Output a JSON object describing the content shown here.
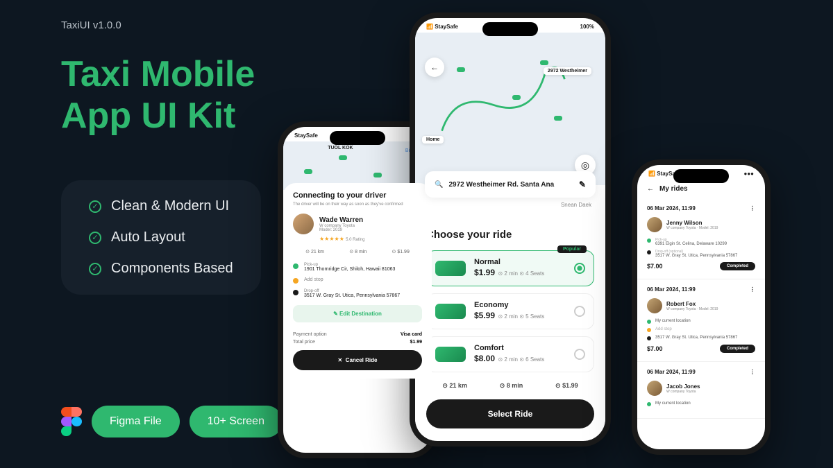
{
  "version": "TaxiUI v1.0.0",
  "title_line1": "Taxi Mobile",
  "title_line2": "App UI Kit",
  "features": [
    "Clean & Modern UI",
    "Auto Layout",
    "Components Based"
  ],
  "pills": [
    "Figma File",
    "10+ Screen"
  ],
  "phone1": {
    "carrier": "StaySafe",
    "map_labels": [
      "TUOL KOK",
      "Big Tree"
    ],
    "sheet_title": "Connecting to your driver",
    "sheet_sub": "The driver will be on their way as soon as they've confirmed",
    "driver_name": "Wade Warren",
    "driver_sub1": "W company Toyota",
    "driver_sub2": "Model: 2019",
    "rating_text": "5.0 Rating",
    "stats": [
      "21 km",
      "8 min",
      "$1.99"
    ],
    "locations": [
      {
        "label": "Pick-up",
        "addr": "1901 Thornridge Cir, Shiloh, Hawaii 81063"
      },
      {
        "label": "Add stop",
        "addr": ""
      },
      {
        "label": "Drop-off",
        "addr": "3517 W. Gray St. Utica, Pennsylvania 57867"
      }
    ],
    "edit_dest": "Edit Destination",
    "payment_label": "Payment option",
    "payment_value": "Visa card",
    "total_label": "Total price",
    "total_value": "$1.99",
    "cancel": "Cancel Ride"
  },
  "phone2": {
    "carrier": "StaySafe",
    "battery": "100%",
    "home_label": "Home",
    "dest_label": "2972 Westheimer",
    "search_addr": "2972 Westheimer Rd. Santa Ana",
    "map_text": "Snean Daek",
    "sheet_title": "Choose your ride",
    "rides": [
      {
        "name": "Normal",
        "price": "$1.99",
        "time": "2 min",
        "seats": "4 Seats",
        "popular": "Popular"
      },
      {
        "name": "Economy",
        "price": "$5.99",
        "time": "2 min",
        "seats": "5 Seats"
      },
      {
        "name": "Comfort",
        "price": "$8.00",
        "time": "2 min",
        "seats": "6 Seats"
      }
    ],
    "stats": [
      "21 km",
      "8 min",
      "$1.99"
    ],
    "select": "Select Ride"
  },
  "phone3": {
    "carrier": "StaySafe",
    "title": "My rides",
    "entries": [
      {
        "date": "06 Mar 2024, 11:99",
        "name": "Jenny Wilson",
        "sub": "W company Toyota · Model: 2019",
        "pickup_label": "Pick-up",
        "pickup": "6391 Elgin St. Celina, Delaware 10299",
        "dropoff_label": "Drop-off (optional)",
        "dropoff": "3517 W. Gray St. Utica, Pennsylvania 57867",
        "price": "$7.00",
        "status": "Completed"
      },
      {
        "date": "06 Mar 2024, 11:99",
        "name": "Robert Fox",
        "sub": "W company Toyota · Model: 2019",
        "pickup_label": "",
        "pickup": "My current location",
        "dropoff_label": "Add stop",
        "dropoff": "3517 W. Gray St. Utica, Pennsylvania 57867",
        "price": "$7.00",
        "status": "Completed"
      },
      {
        "date": "06 Mar 2024, 11:99",
        "name": "Jacob Jones",
        "sub": "W company Toyota",
        "pickup": "My current location"
      }
    ]
  }
}
